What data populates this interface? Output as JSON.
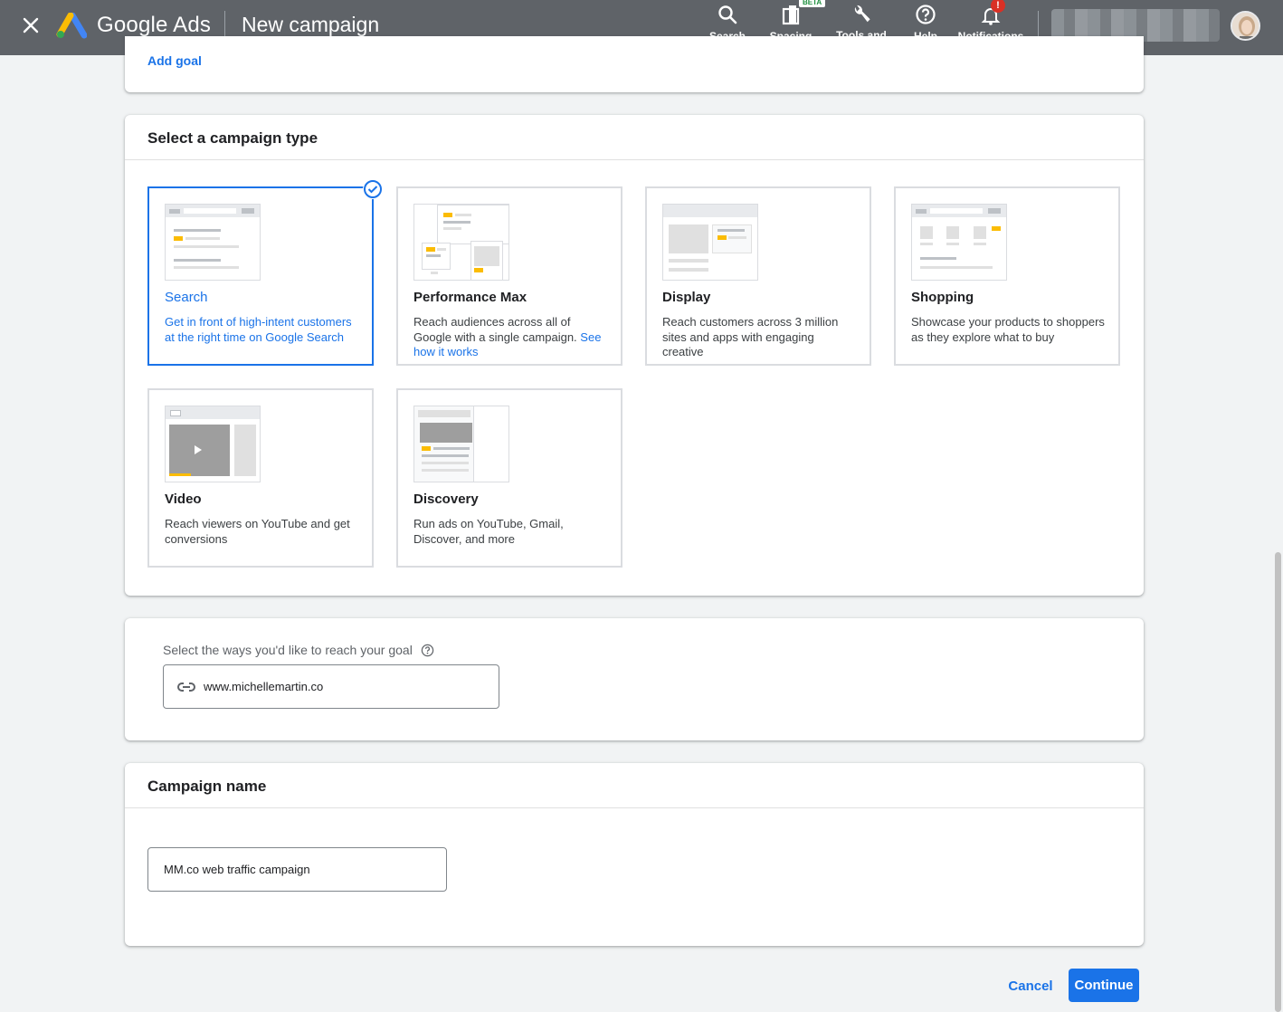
{
  "topbar": {
    "brand": "Google Ads",
    "page_title": "New campaign",
    "actions": [
      {
        "label": "Search",
        "icon": "search-icon"
      },
      {
        "label": "Spacing",
        "icon": "spacing-icon",
        "badge": "BETA"
      },
      {
        "label": "Tools and settings",
        "icon": "wrench-icon"
      },
      {
        "label": "Help",
        "icon": "help-icon"
      },
      {
        "label": "Notifications",
        "icon": "bell-icon",
        "badge": "!"
      }
    ]
  },
  "goal_card": {
    "add_goal": "Add goal"
  },
  "campaign_type": {
    "heading": "Select a campaign type",
    "options": [
      {
        "name": "Search",
        "desc": "Get in front of high-intent customers at the right time on Google Search",
        "selected": true
      },
      {
        "name": "Performance Max",
        "desc": "Reach audiences across all of Google with a single campaign.",
        "link": "See how it works",
        "selected": false
      },
      {
        "name": "Display",
        "desc": "Reach customers across 3 million sites and apps with engaging creative",
        "selected": false
      },
      {
        "name": "Shopping",
        "desc": "Showcase your products to shoppers as they explore what to buy",
        "selected": false
      },
      {
        "name": "Video",
        "desc": "Reach viewers on YouTube and get conversions",
        "selected": false
      },
      {
        "name": "Discovery",
        "desc": "Run ads on YouTube, Gmail, Discover, and more",
        "selected": false
      }
    ]
  },
  "reach": {
    "label": "Select the ways you'd like to reach your goal",
    "website": "www.michellemartin.co"
  },
  "campaign_name": {
    "heading": "Campaign name",
    "value": "MM.co web traffic campaign"
  },
  "footer": {
    "cancel": "Cancel",
    "continue": "Continue"
  },
  "colors": {
    "accent": "#1a73e8",
    "topbar": "#5f6368",
    "highlight": "#fbbc04"
  }
}
